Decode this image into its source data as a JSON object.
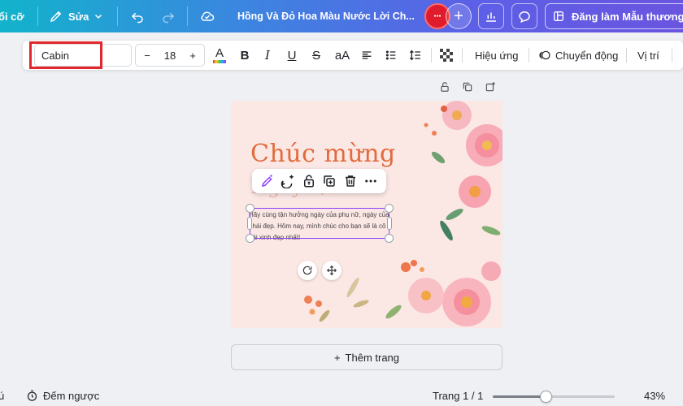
{
  "topbar": {
    "resize_label": "ổi cỡ",
    "edit_label": "Sửa",
    "doc_title": "Hồng Và Đỏ Hoa Màu Nước Lời Ch...",
    "publish_label": "Đăng làm Mẫu thương hi"
  },
  "format": {
    "font_name": "Cabin",
    "font_size": "18",
    "minus": "−",
    "plus": "+",
    "case_label": "aA",
    "effects_label": "Hiệu ứng",
    "animate_label": "Chuyển động",
    "position_label": "Vị trí"
  },
  "design": {
    "headline": "Chúc mừng",
    "headline2": "Ngày 8/3",
    "body": "Hãy cùng tận hưởng ngày của phụ nữ, ngày của phái đẹp. Hôm nay, mình chúc cho bạn sẽ là cô gái xinh đẹp nhất!"
  },
  "canvas": {
    "add_page_label": "Thêm trang"
  },
  "bottombar": {
    "left_fragment": "ú",
    "timer_label": "Đếm ngược",
    "page_indicator": "Trang 1 / 1",
    "zoom_label": "43%",
    "zoom_fraction": 0.43
  },
  "colors": {
    "accent": "#8b3dff",
    "highlight": "#e3262b",
    "headline": "#e16b3c"
  }
}
